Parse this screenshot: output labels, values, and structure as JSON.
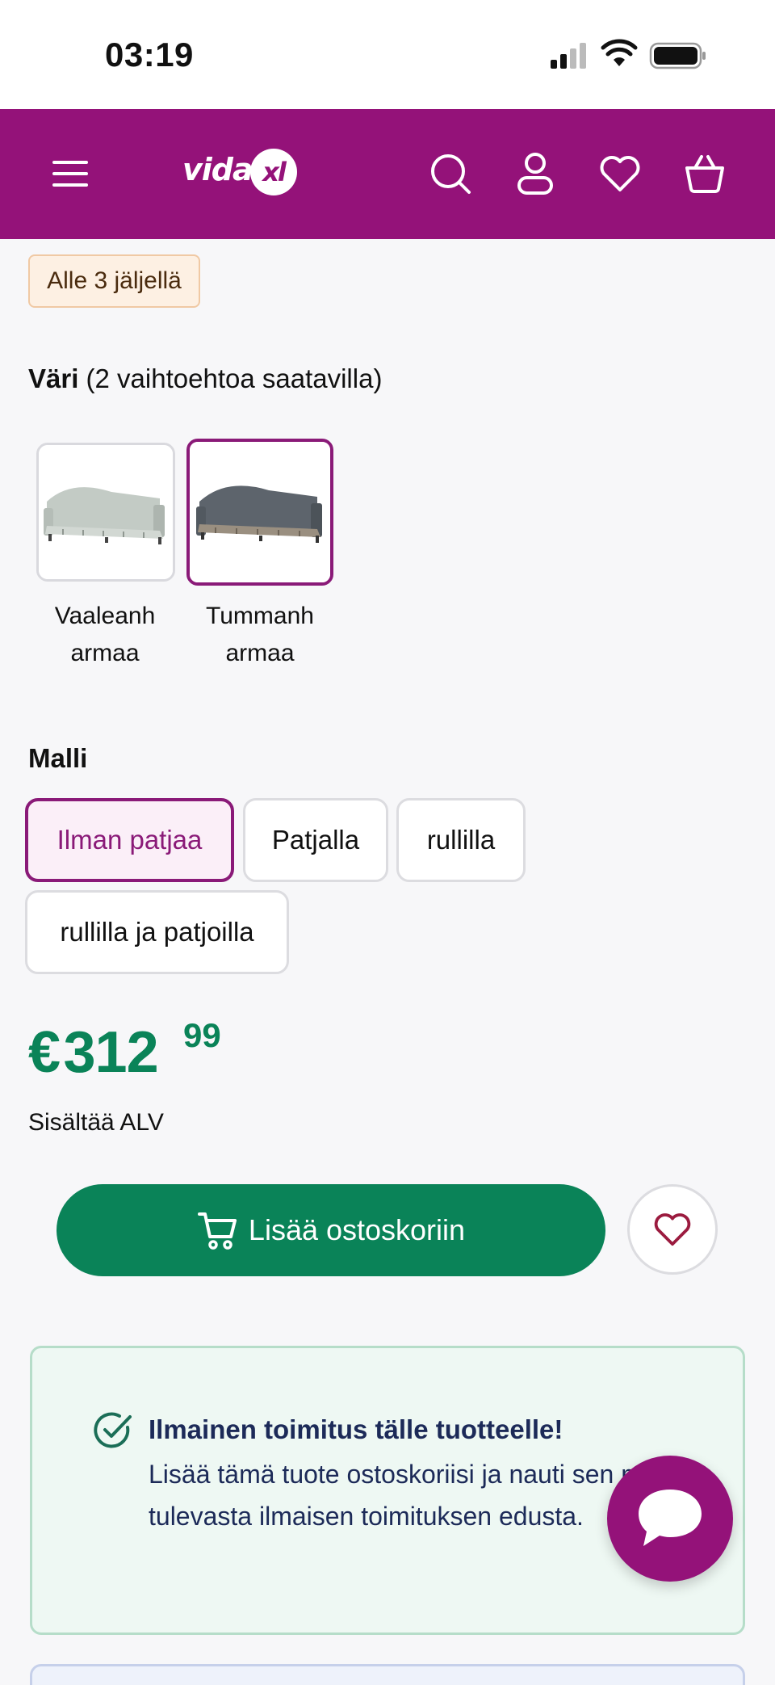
{
  "status_bar": {
    "time": "03:19"
  },
  "header": {
    "logo": {
      "part1": "vida",
      "part2": "xl"
    },
    "icons": [
      "menu-icon",
      "search-icon",
      "account-icon",
      "heart-icon",
      "basket-icon"
    ],
    "background": "#941279"
  },
  "stock_badge": "Alle 3 jäljellä",
  "color_section": {
    "label": "Väri",
    "count_text": "(2 vaihtoehtoa saatavilla)",
    "options": [
      {
        "line1": "Vaaleanh",
        "line2": "armaa",
        "selected": false
      },
      {
        "line1": "Tummanh",
        "line2": "armaa",
        "selected": true
      }
    ]
  },
  "model_section": {
    "label": "Malli",
    "options": [
      {
        "label": "Ilman patjaa",
        "selected": true
      },
      {
        "label": "Patjalla",
        "selected": false
      },
      {
        "label": "rullilla",
        "selected": false
      },
      {
        "label": "rullilla ja patjoilla",
        "selected": false
      }
    ]
  },
  "price": {
    "currency": "€",
    "whole": "312",
    "cents": "99",
    "vat_note": "Sisältää ALV",
    "color": "#0a8358"
  },
  "actions": {
    "add_to_cart": "Lisää ostoskoriin"
  },
  "shipping_notice": {
    "title": "Ilmainen toimitus tälle tuotteelle!",
    "body": "Lisää tämä tuote ostoskoriisi ja nauti sen mukana tulevasta ilmaisen toimituksen edusta."
  },
  "colors": {
    "brand": "#941279",
    "accent_green": "#0a8358",
    "selected_border": "#8a1a78"
  }
}
